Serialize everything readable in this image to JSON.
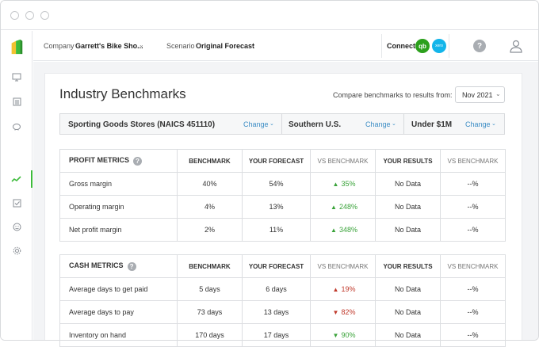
{
  "topbar": {
    "company_label": "Company",
    "company_value": "Garrett's Bike Sho...",
    "scenario_label": "Scenario",
    "scenario_value": "Original Forecast",
    "connect_label": "Connect",
    "qb_label": "qb",
    "xero_label": "xero",
    "help_label": "?"
  },
  "sidebar": {
    "icons": [
      "monitor-icon",
      "ledger-icon",
      "piggy-bank-icon",
      "trend-chart-icon",
      "checklist-icon",
      "face-icon",
      "gear-icon"
    ],
    "active_index": 3
  },
  "page": {
    "title": "Industry Benchmarks",
    "compare_label": "Compare benchmarks to results from:",
    "compare_month": "Nov 2021"
  },
  "filters": [
    {
      "value": "Sporting Goods Stores (NAICS 451110)",
      "action": "Change"
    },
    {
      "value": "Southern U.S.",
      "action": "Change"
    },
    {
      "value": "Under $1M",
      "action": "Change"
    }
  ],
  "columns": [
    "BENCHMARK",
    "YOUR FORECAST",
    "VS BENCHMARK",
    "YOUR RESULTS",
    "VS BENCHMARK"
  ],
  "profit": {
    "title": "PROFIT METRICS",
    "rows": [
      {
        "metric": "Gross margin",
        "benchmark": "40%",
        "forecast": "54%",
        "vs": "35%",
        "dir": "up",
        "results": "No Data",
        "vs2": "--%"
      },
      {
        "metric": "Operating margin",
        "benchmark": "4%",
        "forecast": "13%",
        "vs": "248%",
        "dir": "up",
        "results": "No Data",
        "vs2": "--%"
      },
      {
        "metric": "Net profit margin",
        "benchmark": "2%",
        "forecast": "11%",
        "vs": "348%",
        "dir": "up",
        "results": "No Data",
        "vs2": "--%"
      }
    ]
  },
  "cash": {
    "title": "CASH METRICS",
    "rows": [
      {
        "metric": "Average days to get paid",
        "benchmark": "5 days",
        "forecast": "6 days",
        "vs": "19%",
        "dir": "up-red",
        "results": "No Data",
        "vs2": "--%"
      },
      {
        "metric": "Average days to pay",
        "benchmark": "73 days",
        "forecast": "13 days",
        "vs": "82%",
        "dir": "down-red",
        "results": "No Data",
        "vs2": "--%"
      },
      {
        "metric": "Inventory on hand",
        "benchmark": "170 days",
        "forecast": "17 days",
        "vs": "90%",
        "dir": "down-green",
        "results": "No Data",
        "vs2": "--%"
      }
    ]
  },
  "colors": {
    "accent_green": "#3dbb3b",
    "link_blue": "#3c8dc5",
    "positive": "#3aa33a",
    "negative": "#c0392b"
  }
}
